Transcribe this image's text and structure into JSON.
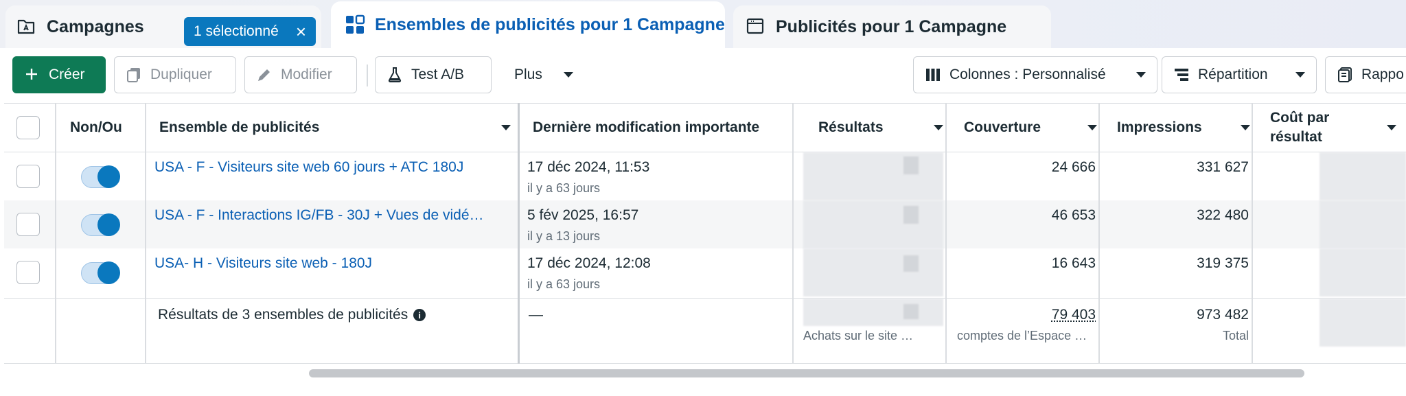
{
  "tabs": {
    "campaigns": {
      "label": "Campagnes",
      "selected_chip": "1 sélectionné"
    },
    "adsets": {
      "label": "Ensembles de publicités pour 1 Campagne"
    },
    "ads": {
      "label": "Publicités pour 1 Campagne"
    }
  },
  "toolbar": {
    "create": "Créer",
    "duplicate": "Dupliquer",
    "edit": "Modifier",
    "ab_test": "Test A/B",
    "more": "Plus",
    "columns": "Colonnes : Personnalisé",
    "breakdown": "Répartition",
    "reports": "Rappo"
  },
  "table": {
    "headers": {
      "onoff": "Non/Ou",
      "adset": "Ensemble de publicités",
      "last_edit": "Dernière modification importante",
      "results": "Résultats",
      "reach": "Couverture",
      "impressions": "Impressions",
      "cost_per_result_1": "Coût par",
      "cost_per_result_2": "résultat"
    },
    "rows": [
      {
        "name": "USA - F - Visiteurs site web 60 jours + ATC 180J",
        "date": "17 déc 2024, 11:53",
        "ago": "il y a 63 jours",
        "reach": "24 666",
        "impressions": "331 627",
        "enabled": true
      },
      {
        "name": "USA - F - Interactions IG/FB - 30J + Vues de vidé…",
        "date": "5 fév 2025, 16:57",
        "ago": "il y a 13 jours",
        "reach": "46 653",
        "impressions": "322 480",
        "enabled": true
      },
      {
        "name": "USA- H - Visiteurs site web - 180J",
        "date": "17 déc 2024, 12:08",
        "ago": "il y a 63 jours",
        "reach": "16 643",
        "impressions": "319 375",
        "enabled": true
      }
    ],
    "totals": {
      "label": "Résultats de 3 ensembles de publicités",
      "last_edit": "—",
      "results_sub": "Achats sur le site …",
      "reach": "79 403",
      "reach_sub": "comptes de l’Espace …",
      "impressions": "973 482",
      "impressions_sub": "Total"
    }
  },
  "colors": {
    "accent": "#0a5fb4",
    "create_button": "#0e7a55",
    "toggle": "#0a78be"
  }
}
